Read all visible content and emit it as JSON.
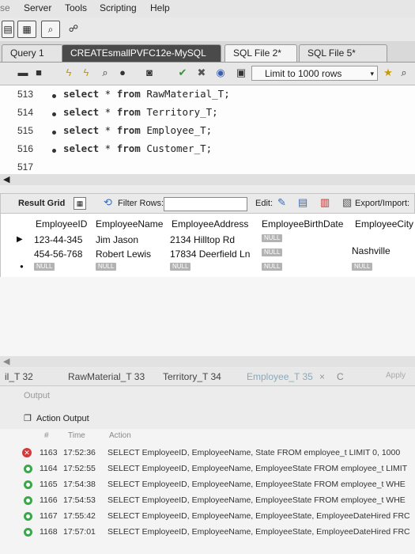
{
  "menu": {
    "items": [
      "se",
      "Server",
      "Tools",
      "Scripting",
      "Help"
    ]
  },
  "tabs": [
    {
      "label": "Query 1"
    },
    {
      "label": "CREATEsmallPVFC12e-MySQL"
    },
    {
      "label": "SQL File 2*"
    },
    {
      "label": "SQL File 5*"
    }
  ],
  "editor_toolbar": {
    "limit_label": "Limit to 1000 rows"
  },
  "editor": {
    "lines": [
      {
        "no": "513",
        "kw1": "select",
        "mid": " * ",
        "kw2": "from",
        "rest": " RawMaterial_T;"
      },
      {
        "no": "514",
        "kw1": "select",
        "mid": " * ",
        "kw2": "from",
        "rest": " Territory_T;"
      },
      {
        "no": "515",
        "kw1": "select",
        "mid": " * ",
        "kw2": "from",
        "rest": " Employee_T;"
      },
      {
        "no": "516",
        "kw1": "select",
        "mid": " * ",
        "kw2": "from",
        "rest": " Customer_T;"
      },
      {
        "no": "517"
      }
    ]
  },
  "grid_toolbar": {
    "result_grid": "Result Grid",
    "filter_rows": "Filter Rows:",
    "edit": "Edit:",
    "export_import": "Export/Import:"
  },
  "grid": {
    "columns": [
      "EmployeeID",
      "EmployeeName",
      "EmployeeAddress",
      "EmployeeBirthDate",
      "EmployeeCity"
    ],
    "null_text": "NULL",
    "rows": [
      {
        "id": "123-44-345",
        "name": "Jim Jason",
        "address": "2134 Hilltop Rd",
        "birth": "NULL",
        "city": ""
      },
      {
        "id": "454-56-768",
        "name": "Robert Lewis",
        "address": "17834 Deerfield Ln",
        "birth": "NULL",
        "city": "Nashville"
      }
    ]
  },
  "result_tabs": [
    "il_T 32",
    "RawMaterial_T 33",
    "Territory_T 34",
    "Employee_T 35",
    "Apply"
  ],
  "output": {
    "header": "Output",
    "action_output": "Action Output",
    "col_num": "#",
    "col_time": "Time",
    "col_action": "Action",
    "rows": [
      {
        "num": "1163",
        "time": "17:52:36",
        "action": "SELECT EmployeeID, EmployeeName, State FROM employee_t LIMIT 0, 1000",
        "status": "error"
      },
      {
        "num": "1164",
        "time": "17:52:55",
        "action": "SELECT EmployeeID, EmployeeName, EmployeeState FROM employee_t LIMIT",
        "status": "ok"
      },
      {
        "num": "1165",
        "time": "17:54:38",
        "action": "SELECT EmployeeID, EmployeeName, EmployeeState FROM employee_t WHE",
        "status": "ok"
      },
      {
        "num": "1166",
        "time": "17:54:53",
        "action": "SELECT EmployeeID, EmployeeName, EmployeeState FROM employee_t WHE",
        "status": "ok"
      },
      {
        "num": "1167",
        "time": "17:55:42",
        "action": "SELECT EmployeeID, EmployeeName, EmployeeState, EmployeeDateHired FRC",
        "status": "ok"
      },
      {
        "num": "1168",
        "time": "17:57:01",
        "action": "SELECT EmployeeID, EmployeeName, EmployeeState, EmployeeDateHired FRC",
        "status": "ok"
      }
    ]
  }
}
